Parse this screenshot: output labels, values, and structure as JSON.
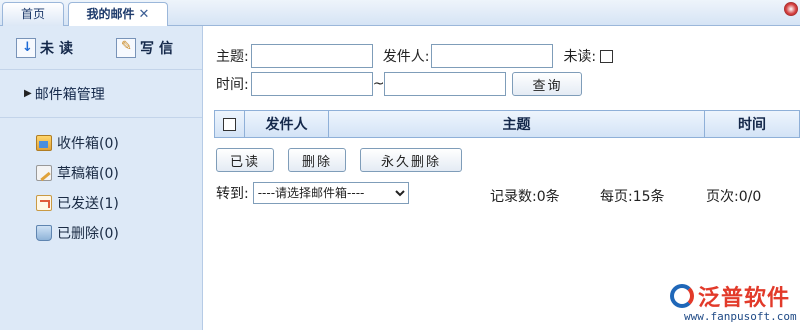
{
  "tabs": [
    {
      "label": "首页"
    },
    {
      "label": "我的邮件",
      "close": "✕"
    }
  ],
  "sidebar": {
    "actions": {
      "unread": "未读",
      "write": "写信"
    },
    "group": "邮件箱管理",
    "folders": [
      {
        "label": "收件箱(0)"
      },
      {
        "label": "草稿箱(0)"
      },
      {
        "label": "已发送(1)"
      },
      {
        "label": "已删除(0)"
      }
    ]
  },
  "search": {
    "subject_label": "主题:",
    "sender_label": "发件人:",
    "unread_label": "未读:",
    "time_label": "时间:",
    "range_sep": "~",
    "subject_value": "",
    "sender_value": "",
    "time_from": "",
    "time_to": "",
    "query_button": "查询"
  },
  "grid": {
    "columns": [
      "发件人",
      "主题",
      "时间"
    ]
  },
  "toolbar": {
    "read_button": "已读",
    "delete_button": "删除",
    "perm_delete_button": "永久删除"
  },
  "move": {
    "label": "转到:",
    "selected": "----请选择邮件箱----"
  },
  "stats": {
    "records": "记录数:0条",
    "per_page": "每页:15条",
    "page": "页次:0/0"
  },
  "logo": {
    "name": "泛普软件",
    "url": "www.fanpusoft.com"
  }
}
